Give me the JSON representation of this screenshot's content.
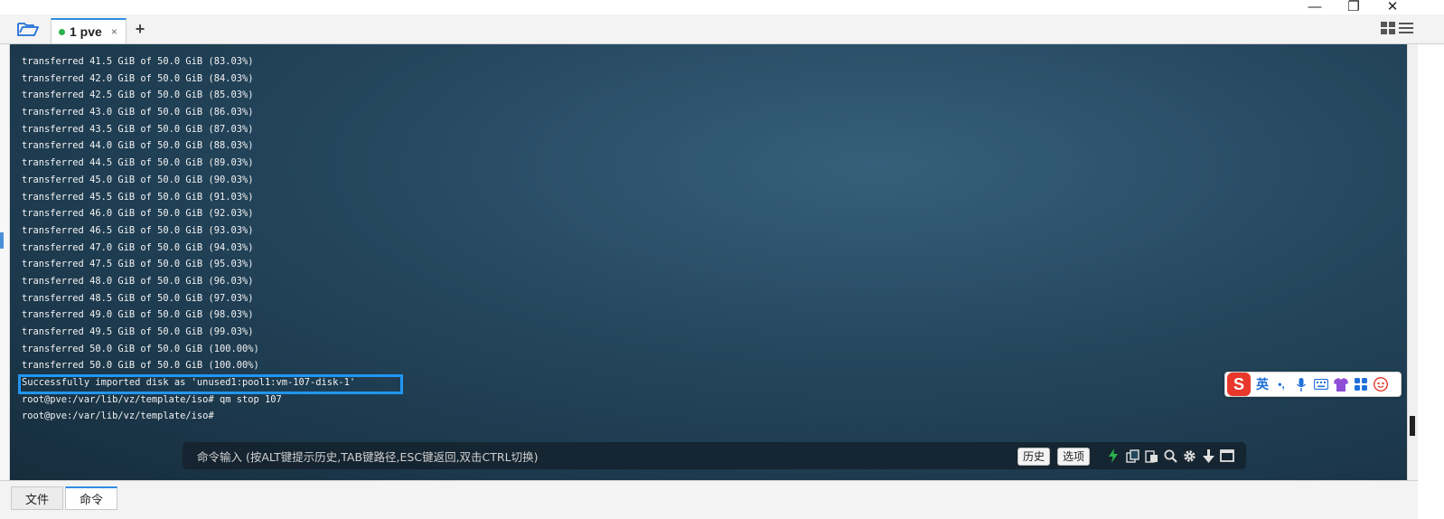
{
  "window": {
    "minimize_glyph": "—",
    "restore_glyph": "❐",
    "close_glyph": "✕"
  },
  "tabbar": {
    "tabs": [
      {
        "label": "1 pve",
        "status_color": "#2bb24c",
        "active": true
      }
    ],
    "close_glyph": "×",
    "add_glyph": "+"
  },
  "terminal": {
    "lines": [
      "transferred 41.5 GiB of 50.0 GiB (83.03%)",
      "transferred 42.0 GiB of 50.0 GiB (84.03%)",
      "transferred 42.5 GiB of 50.0 GiB (85.03%)",
      "transferred 43.0 GiB of 50.0 GiB (86.03%)",
      "transferred 43.5 GiB of 50.0 GiB (87.03%)",
      "transferred 44.0 GiB of 50.0 GiB (88.03%)",
      "transferred 44.5 GiB of 50.0 GiB (89.03%)",
      "transferred 45.0 GiB of 50.0 GiB (90.03%)",
      "transferred 45.5 GiB of 50.0 GiB (91.03%)",
      "transferred 46.0 GiB of 50.0 GiB (92.03%)",
      "transferred 46.5 GiB of 50.0 GiB (93.03%)",
      "transferred 47.0 GiB of 50.0 GiB (94.03%)",
      "transferred 47.5 GiB of 50.0 GiB (95.03%)",
      "transferred 48.0 GiB of 50.0 GiB (96.03%)",
      "transferred 48.5 GiB of 50.0 GiB (97.03%)",
      "transferred 49.0 GiB of 50.0 GiB (98.03%)",
      "transferred 49.5 GiB of 50.0 GiB (99.03%)",
      "transferred 50.0 GiB of 50.0 GiB (100.00%)",
      "transferred 50.0 GiB of 50.0 GiB (100.00%)",
      "Successfully imported disk as 'unused1:pool1:vm-107-disk-1'",
      "root@pve:/var/lib/vz/template/iso# qm stop 107",
      "root@pve:/var/lib/vz/template/iso#"
    ],
    "highlight_color": "#2196f3"
  },
  "ime": {
    "logo": "S",
    "lang": "英",
    "punct": "•,",
    "brand_color": "#e8372b"
  },
  "command_bar": {
    "placeholder": "命令输入 (按ALT键提示历史,TAB键路径,ESC键返回,双击CTRL切换)",
    "history_label": "历史",
    "options_label": "选项"
  },
  "bottom_tabs": [
    {
      "label": "文件",
      "active": false
    },
    {
      "label": "命令",
      "active": true
    }
  ],
  "grip": "....",
  "colors": {
    "accent": "#2f8de4",
    "terminal_text": "#f2f2f2",
    "lightning": "#2bb24c"
  }
}
